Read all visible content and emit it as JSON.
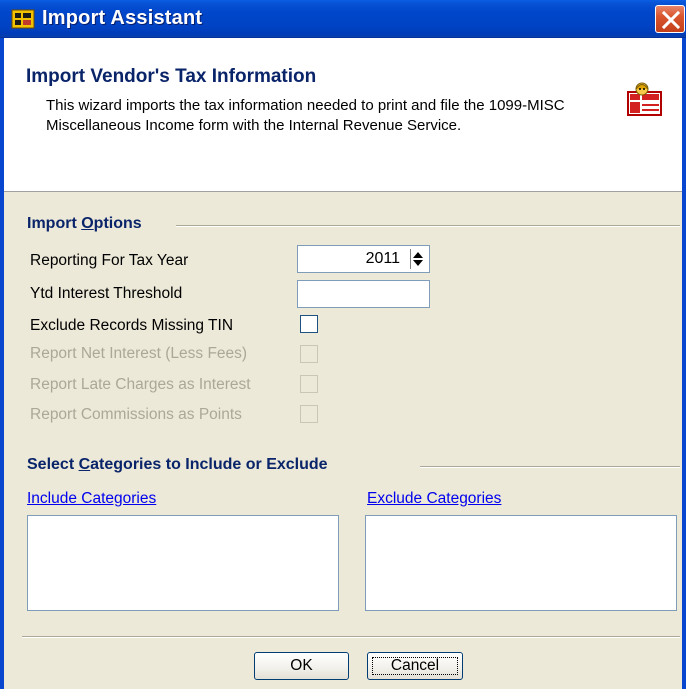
{
  "window": {
    "title": "Import Assistant",
    "close_icon": "close-icon"
  },
  "header": {
    "title": "Import Vendor's Tax Information",
    "description": "This wizard imports the tax information needed to print and file the 1099-MISC Miscellaneous Income form with the Internal Revenue Service.",
    "icon": "tax-form-icon"
  },
  "import_options": {
    "title_pre": "Import ",
    "title_hotkey": "O",
    "title_post": "ptions",
    "tax_year_label": "Reporting For Tax Year",
    "tax_year_value": "2011",
    "ytd_threshold_label": "Ytd Interest Threshold",
    "ytd_threshold_value": "",
    "exclude_missing_tin_label": "Exclude Records Missing TIN",
    "report_net_interest_label": "Report Net Interest (Less Fees)",
    "report_late_charges_label": "Report Late Charges as Interest",
    "report_commissions_label": "Report Commissions as Points"
  },
  "categories": {
    "title_pre": "Select ",
    "title_hotkey": "C",
    "title_post": "ategories to Include or Exclude",
    "include_label": "Include Categories",
    "exclude_label": "Exclude Categories"
  },
  "buttons": {
    "ok_label": "OK",
    "cancel_label": "Cancel"
  }
}
